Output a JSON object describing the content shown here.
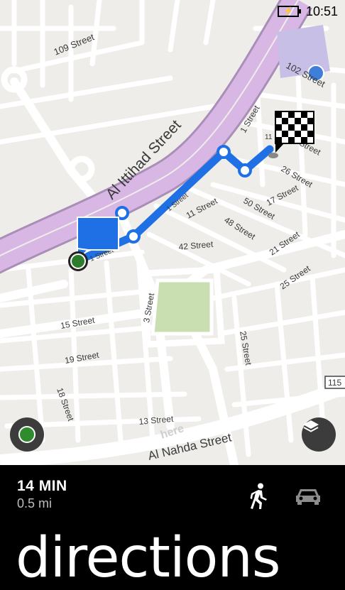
{
  "status_bar": {
    "battery": "⚡",
    "time": "10:51"
  },
  "map": {
    "streets": {
      "main_road": "Al Ittihad Street",
      "south_road": "Al Nahda Street",
      "s109": "109 Street",
      "s102": "102 Street",
      "s1_top": "1 Street",
      "s64": "64 Street",
      "s26": "26 Street",
      "s17": "17 Street",
      "s50": "50 Street",
      "s11": "11 Street",
      "s48": "48 Street",
      "s42": "42 Street",
      "s21": "21 Street",
      "s25": "25 Street",
      "s15": "15 Street",
      "s3": "3 Street",
      "s19": "19 Street",
      "s18": "18 Street",
      "s13": "13 Street",
      "s25b": "25 Street",
      "route_1a": "1 Street",
      "route_1b": "1 Street",
      "route_11": "11"
    },
    "road_shield": "115",
    "watermark": "here",
    "colors": {
      "route": "#1f6fe5",
      "main_road": "#c9a3d6",
      "park": "#c9dfb2"
    }
  },
  "route_summary": {
    "duration": "14 MIN",
    "distance": "0.5 mi",
    "selected_mode": "walk"
  },
  "page_title": "directions"
}
